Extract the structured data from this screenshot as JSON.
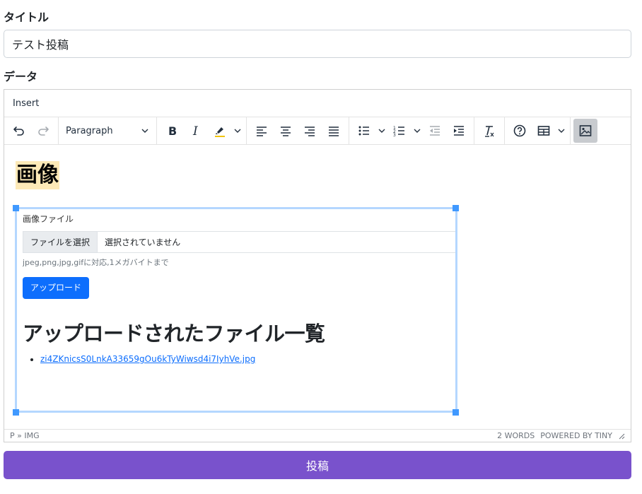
{
  "form": {
    "title_label": "タイトル",
    "title_value": "テスト投稿",
    "data_label": "データ",
    "submit_label": "投稿"
  },
  "editor": {
    "menubar": {
      "insert": "Insert"
    },
    "toolbar": {
      "block_format": "Paragraph"
    },
    "content": {
      "heading": "画像",
      "embed": {
        "file_label": "画像ファイル",
        "choose_file_button": "ファイルを選択",
        "no_file_text": "選択されていません",
        "help_text": "jpeg,png,jpg,gifに対応,1メガバイトまで",
        "upload_button": "アップロード",
        "list_heading": "アップロードされたファイル一覧",
        "files": [
          "zi4ZKnicsS0LnkA33659gOu6kTyWiwsd4i7IyhVe.jpg"
        ]
      }
    },
    "statusbar": {
      "path": "P » IMG",
      "word_count": "2 WORDS",
      "branding": "POWERED BY TINY"
    }
  },
  "colors": {
    "submit_bg": "#7952cc",
    "heading_highlight": "#fde9b7",
    "selection_border": "#b4d7ff",
    "selection_handle": "#4099ff",
    "upload_button_bg": "#0d6efd"
  }
}
